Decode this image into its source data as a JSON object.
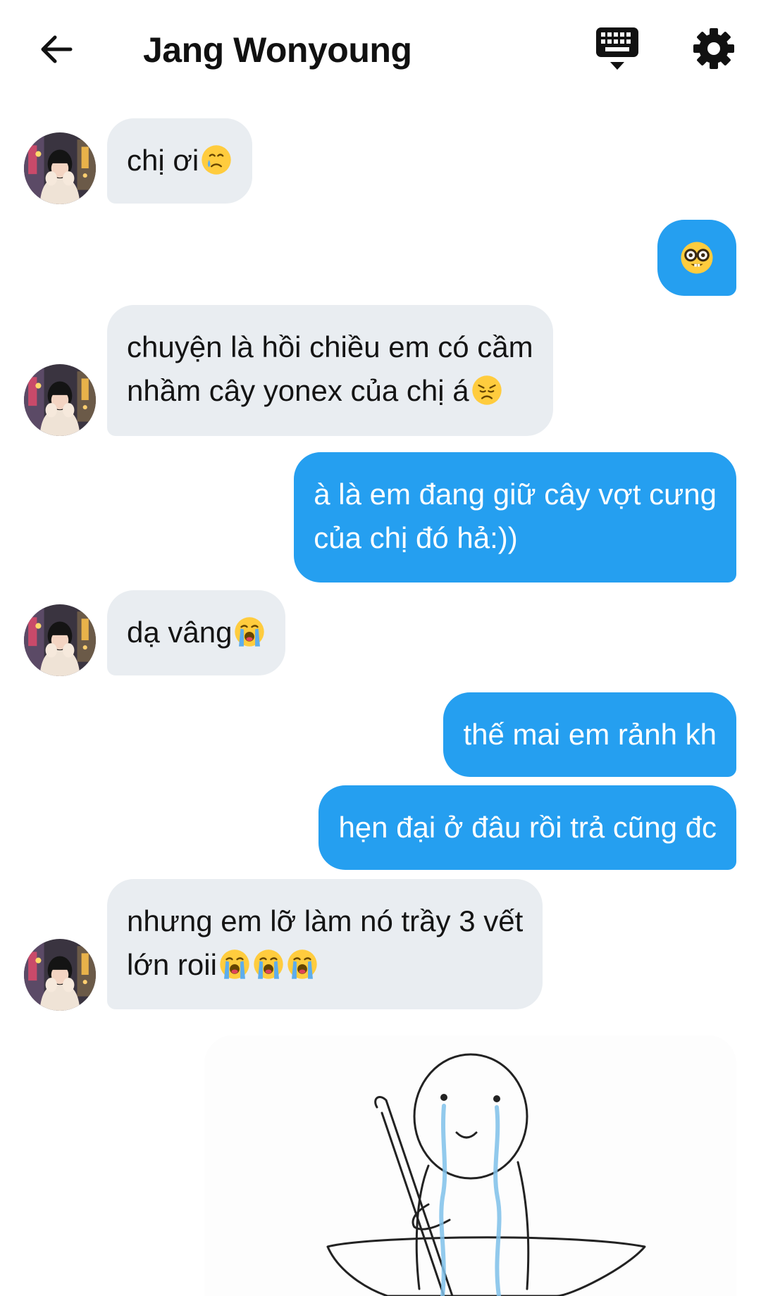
{
  "header": {
    "title": "Jang Wonyoung",
    "icons": [
      "back-arrow-icon",
      "keyboard-icon",
      "gear-icon"
    ]
  },
  "colors": {
    "incoming_bubble": "#e9edf1",
    "outgoing_bubble": "#259ff0",
    "outgoing_text": "#ffffff"
  },
  "messages": [
    {
      "from": "them",
      "lines": [
        "chị ơi"
      ],
      "emoji_after": [
        "crying-face-emoji"
      ]
    },
    {
      "from": "me",
      "lines": [],
      "emoji_after": [
        "nerd-face-emoji"
      ]
    },
    {
      "from": "them",
      "lines": [
        "chuyện là hồi chiều em có cầm",
        "nhầm cây yonex của chị á"
      ],
      "emoji_after": [
        "disappointed-face-emoji"
      ]
    },
    {
      "from": "me",
      "lines": [
        "à là em đang giữ cây vợt cưng",
        "của chị đó hả:))"
      ]
    },
    {
      "from": "them",
      "lines": [
        "dạ vâng"
      ],
      "emoji_after": [
        "loudly-crying-face-emoji"
      ]
    },
    {
      "from": "me",
      "lines": [
        "thế mai em rảnh kh"
      ]
    },
    {
      "from": "me",
      "lines": [
        "hẹn đại ở đâu rồi trả cũng đc"
      ]
    },
    {
      "from": "them",
      "lines": [
        "nhưng em lỡ làm nó trầy 3 vết",
        "lớn roii"
      ],
      "emoji_after": [
        "loudly-crying-face-emoji",
        "loudly-crying-face-emoji",
        "loudly-crying-face-emoji"
      ]
    }
  ],
  "sticker": {
    "icon": "crying-stickman-eating-sticker"
  }
}
